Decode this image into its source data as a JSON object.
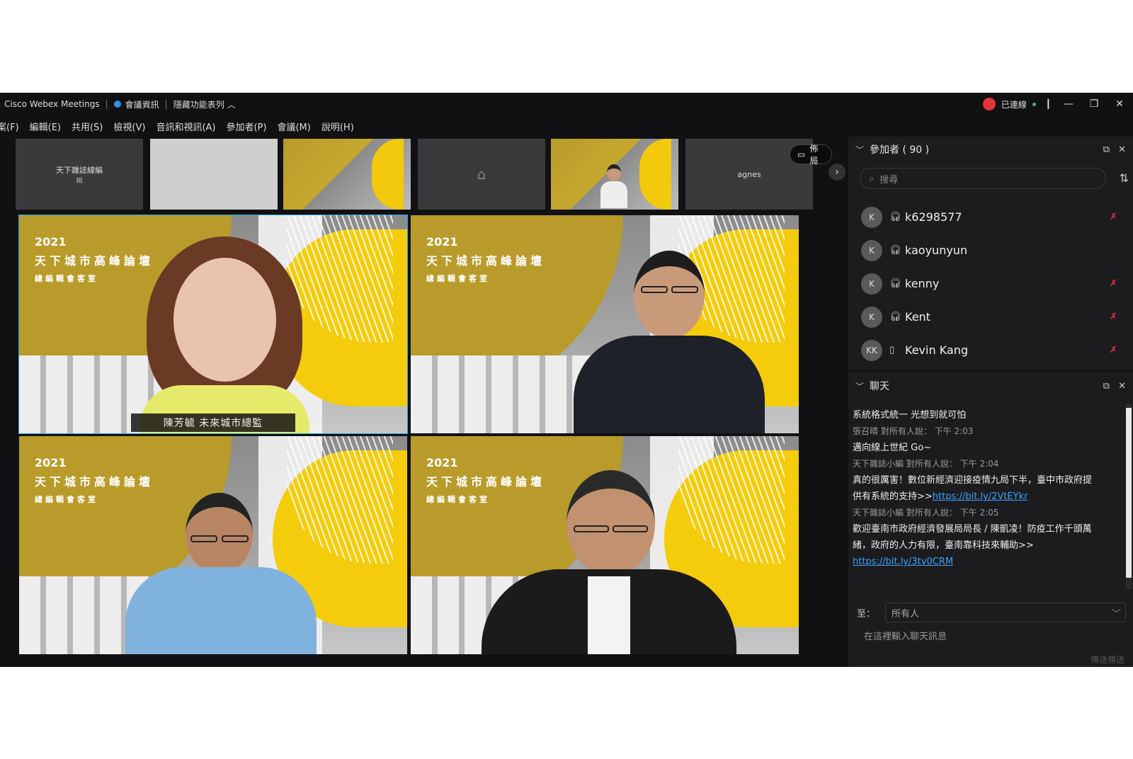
{
  "titlebar": {
    "app_title": "Cisco Webex Meetings",
    "meeting_info": "會議資訊",
    "hidden_toolbar": "隱藏功能表列",
    "recording_status": "已連線"
  },
  "menu": [
    "案(F)",
    "編輯(E)",
    "共用(S)",
    "檢視(V)",
    "音訊和視訊(A)",
    "參加者(P)",
    "會議(M)",
    "說明(H)"
  ],
  "strip": {
    "thumb1_name": "天下雜誌線編",
    "thumb1_sub": "輯",
    "thumb6_name": "agnes",
    "layout_label": "佈局"
  },
  "tiles": {
    "poster_year": "2021",
    "poster_title": "天下城市高峰論壇",
    "poster_sub": "總編輯會客室",
    "speaker_caption": "陳芳毓 未來城市總監"
  },
  "participants": {
    "header": "參加者 ( 90 )",
    "search_placeholder": "搜尋",
    "list": [
      {
        "initials": "K",
        "name": "k6298577",
        "muted": true
      },
      {
        "initials": "K",
        "name": "kaoyunyun",
        "muted": false
      },
      {
        "initials": "K",
        "name": "kenny",
        "muted": true
      },
      {
        "initials": "K",
        "name": "Kent",
        "muted": true
      },
      {
        "initials": "KK",
        "name": "Kevin Kang",
        "muted": true
      }
    ]
  },
  "chat": {
    "header": "聊天",
    "messages": [
      {
        "type": "text",
        "text": "系統格式統一 光想到就可怕"
      },
      {
        "type": "meta",
        "text": "張召晴 對所有人說： 下午 2:03"
      },
      {
        "type": "text",
        "text": "邁向線上世紀 Go~"
      },
      {
        "type": "meta",
        "text": "天下雜誌小編 對所有人說： 下午 2:04"
      },
      {
        "type": "text",
        "text": "真的很厲害！數位新經濟迎接疫情九局下半，臺中市政府提"
      },
      {
        "type": "text",
        "text": "供有系統的支持>>"
      },
      {
        "type": "link",
        "text": "https://bit.ly/2VtEYkr"
      },
      {
        "type": "meta",
        "text": "天下雜誌小編 對所有人說： 下午 2:05"
      },
      {
        "type": "text",
        "text": "歡迎臺南市政府經濟發展局局長 / 陳凱凌！防疫工作千頭萬"
      },
      {
        "type": "text",
        "text": "緒，政府的人力有限，臺南靠科技來輔助>>"
      },
      {
        "type": "link",
        "text": "https://bit.ly/3tv0CRM"
      }
    ],
    "to_label": "至：",
    "to_value": "所有人",
    "input_placeholder": "在這裡輸入聊天訊息",
    "send_label": "傳送傳送"
  },
  "colors": {
    "accent": "#21a5e6",
    "mute_red": "#e0363b",
    "gold": "#b89b2a",
    "yellow": "#f4cc0c"
  }
}
